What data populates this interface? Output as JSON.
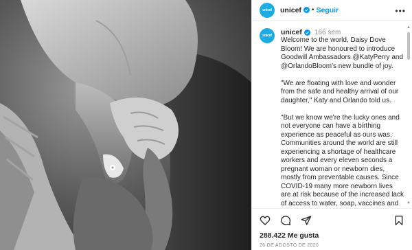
{
  "header": {
    "username": "unicef",
    "separator": "•",
    "follow_label": "Seguir",
    "more_label": "•••",
    "avatar_text": "unicef"
  },
  "caption": {
    "username": "unicef",
    "time_ago": "166 sem",
    "text": "Welcome to the world, Daisy Dove Bloom! We are honoured to introduce Goodwill Ambassadors @KatyPerry and @OrlandoBloom's new bundle of joy.\n\n\"We are floating with love and wonder from the safe and healthy arrival of our daughter,\" Katy and Orlando told us.\n\n\"But we know we're the lucky ones and not everyone can have a birthing experience as peaceful as ours was. Communities around the world are still experiencing a shortage of healthcare workers and every eleven seconds a pregnant woman or newborn dies, mostly from preventable causes. Since COVID-19 many more newborn lives are at risk because of the increased lack of access to water, soap, vaccines and"
  },
  "actions": {
    "likes_count": "288.422",
    "likes_label": "Me gusta",
    "date": "26 DE AGOSTO DE 2020"
  },
  "icons": {
    "like": "heart-icon",
    "comment": "comment-icon",
    "share": "share-icon",
    "save": "bookmark-icon",
    "verified": "verified-badge-icon"
  },
  "colors": {
    "brand_unicef": "#1cabe2",
    "verified": "#0095f6",
    "link": "#0095f6",
    "text": "#262626",
    "muted": "#8e8e8e"
  }
}
